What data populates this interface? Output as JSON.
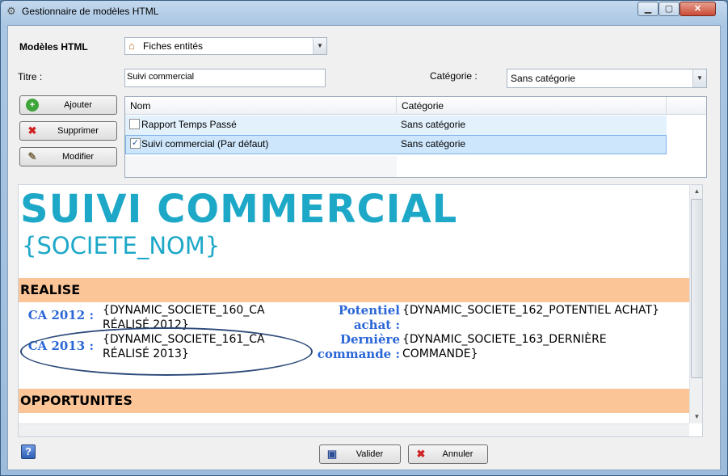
{
  "window": {
    "title": "Gestionnaire de modèles HTML",
    "controls": {
      "minimize": "▁",
      "maximize": "▢",
      "close": "✕"
    }
  },
  "modeles": {
    "label": "Modèles HTML",
    "selected": "Fiches entités"
  },
  "titre": {
    "label": "Titre :",
    "value": "Suivi commercial"
  },
  "categorie": {
    "label": "Catégorie :",
    "selected": "Sans catégorie"
  },
  "actions": {
    "add": "Ajouter",
    "delete": "Supprimer",
    "edit": "Modifier"
  },
  "grid": {
    "columns": [
      "Nom",
      "Catégorie"
    ],
    "rows": [
      {
        "name": "Rapport Temps Passé",
        "category": "Sans catégorie",
        "checked": false,
        "selected": false
      },
      {
        "name": "Suivi commercial (Par défaut)",
        "category": "Sans catégorie",
        "checked": true,
        "selected": true
      }
    ]
  },
  "preview": {
    "title": "SUIVI COMMERCIAL",
    "subtitle": "{SOCIETE_NOM}",
    "section1": "REALISE",
    "fields": [
      {
        "label1": "CA 2012 :",
        "value1": "{DYNAMIC_SOCIETE_160_CA RÉALISÉ 2012}",
        "label2": "Potentiel achat :",
        "value2": "{DYNAMIC_SOCIETE_162_POTENTIEL ACHAT}"
      },
      {
        "label1": "CA 2013 :",
        "value1": "{DYNAMIC_SOCIETE_161_CA RÉALISÉ 2013}",
        "label2": "Dernière commande :",
        "value2": "{DYNAMIC_SOCIETE_163_DERNIÈRE COMMANDE}"
      }
    ],
    "section2": "OPPORTUNITES"
  },
  "footer": {
    "help": "?",
    "validate": "Valider",
    "cancel": "Annuler"
  },
  "colors": {
    "accent_title": "#1ea8c8",
    "band": "#fbc597",
    "field_label": "#2a66d6",
    "selection": "#cde6fb"
  }
}
